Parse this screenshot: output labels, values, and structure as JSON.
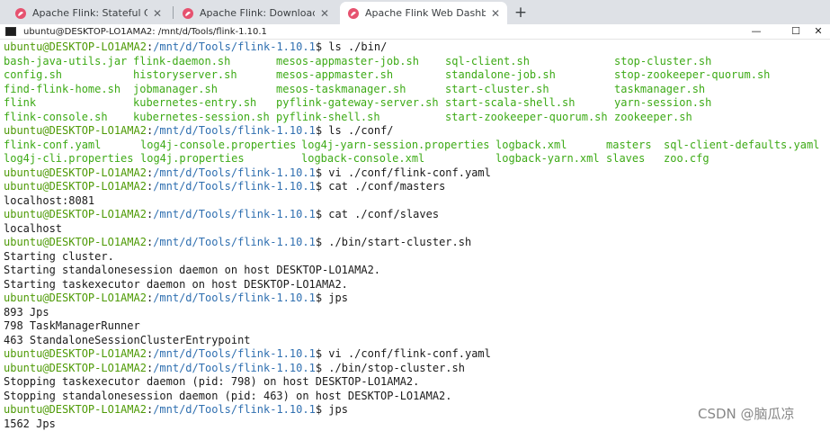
{
  "browser": {
    "tabs": [
      {
        "label": "Apache Flink: Stateful Compu",
        "active": false
      },
      {
        "label": "Apache Flink: Downloads",
        "active": false
      },
      {
        "label": "Apache Flink Web Dashboard",
        "active": true
      }
    ],
    "tab_close_glyph": "✕",
    "new_tab_glyph": "+"
  },
  "window": {
    "title": "ubuntu@DESKTOP-LO1AMA2: /mnt/d/Tools/flink-1.10.1",
    "minimize_glyph": "—",
    "maximize_glyph": "☐",
    "close_glyph": "✕"
  },
  "colors": {
    "prompt": "#4e9a06",
    "path": "#2f6fb0",
    "file_listing": "#3daa16",
    "text": "#1a1a1a"
  },
  "terminal": {
    "prompt_user": "ubuntu@DESKTOP-LO1AMA2",
    "prompt_path": "/mnt/d/Tools/flink-1.10.1",
    "lines": [
      {
        "kind": "cmd",
        "text": "ls ./bin/"
      },
      {
        "kind": "cols",
        "items": [
          "bash-java-utils.jar",
          "flink-daemon.sh",
          "mesos-appmaster-job.sh",
          "sql-client.sh",
          "stop-cluster.sh"
        ]
      },
      {
        "kind": "cols",
        "items": [
          "config.sh",
          "historyserver.sh",
          "mesos-appmaster.sh",
          "standalone-job.sh",
          "stop-zookeeper-quorum.sh"
        ]
      },
      {
        "kind": "cols",
        "items": [
          "find-flink-home.sh",
          "jobmanager.sh",
          "mesos-taskmanager.sh",
          "start-cluster.sh",
          "taskmanager.sh"
        ]
      },
      {
        "kind": "cols",
        "items": [
          "flink",
          "kubernetes-entry.sh",
          "pyflink-gateway-server.sh",
          "start-scala-shell.sh",
          "yarn-session.sh"
        ]
      },
      {
        "kind": "cols",
        "items": [
          "flink-console.sh",
          "kubernetes-session.sh",
          "pyflink-shell.sh",
          "start-zookeeper-quorum.sh",
          "zookeeper.sh"
        ]
      },
      {
        "kind": "cmd",
        "text": "ls ./conf/"
      },
      {
        "kind": "cols2",
        "items": [
          "flink-conf.yaml",
          "log4j-console.properties",
          "log4j-yarn-session.properties",
          "logback.xml",
          "masters",
          "sql-client-defaults.yaml"
        ]
      },
      {
        "kind": "cols2",
        "items": [
          "log4j-cli.properties",
          "log4j.properties",
          "logback-console.xml",
          "logback-yarn.xml",
          "slaves",
          "zoo.cfg"
        ]
      },
      {
        "kind": "cmd",
        "text": "vi ./conf/flink-conf.yaml"
      },
      {
        "kind": "cmd",
        "text": "cat ./conf/masters"
      },
      {
        "kind": "out",
        "text": "localhost:8081"
      },
      {
        "kind": "cmd",
        "text": "cat ./conf/slaves"
      },
      {
        "kind": "out",
        "text": "localhost"
      },
      {
        "kind": "cmd",
        "text": "./bin/start-cluster.sh"
      },
      {
        "kind": "out",
        "text": "Starting cluster."
      },
      {
        "kind": "out",
        "text": "Starting standalonesession daemon on host DESKTOP-LO1AMA2."
      },
      {
        "kind": "out",
        "text": "Starting taskexecutor daemon on host DESKTOP-LO1AMA2."
      },
      {
        "kind": "cmd",
        "text": "jps"
      },
      {
        "kind": "out",
        "text": "893 Jps"
      },
      {
        "kind": "out",
        "text": "798 TaskManagerRunner"
      },
      {
        "kind": "out",
        "text": "463 StandaloneSessionClusterEntrypoint"
      },
      {
        "kind": "cmd",
        "text": "vi ./conf/flink-conf.yaml"
      },
      {
        "kind": "cmd",
        "text": "./bin/stop-cluster.sh"
      },
      {
        "kind": "out",
        "text": "Stopping taskexecutor daemon (pid: 798) on host DESKTOP-LO1AMA2."
      },
      {
        "kind": "out",
        "text": "Stopping standalonesession daemon (pid: 463) on host DESKTOP-LO1AMA2."
      },
      {
        "kind": "cmd",
        "text": "jps"
      },
      {
        "kind": "out",
        "text": "1562 Jps"
      }
    ]
  },
  "watermark": "CSDN @脑瓜凉"
}
